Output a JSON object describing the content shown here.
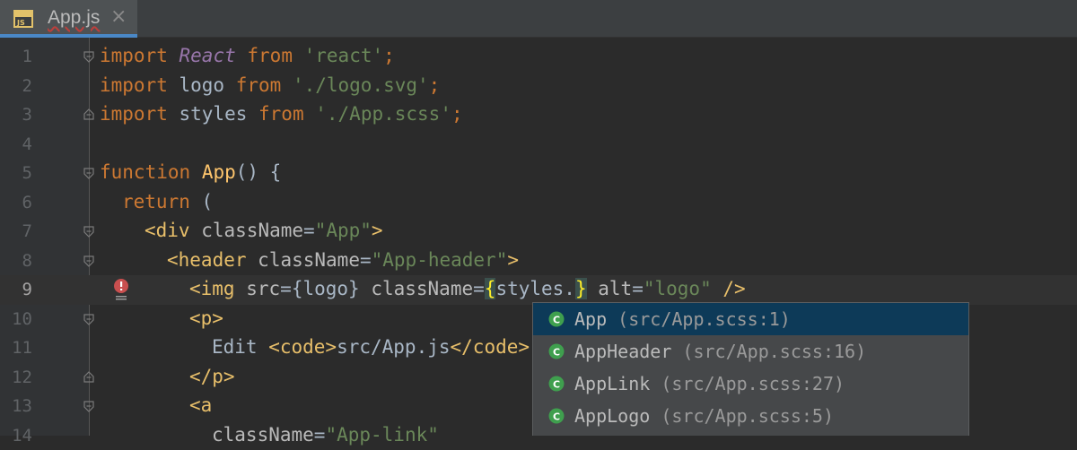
{
  "tab": {
    "title": "App.js",
    "icon_label": "JS",
    "close": "×"
  },
  "editor": {
    "current_line": 9,
    "lines": [
      {
        "n": "1"
      },
      {
        "n": "2"
      },
      {
        "n": "3"
      },
      {
        "n": "4"
      },
      {
        "n": "5"
      },
      {
        "n": "6"
      },
      {
        "n": "7"
      },
      {
        "n": "8"
      },
      {
        "n": "9"
      },
      {
        "n": "10"
      },
      {
        "n": "11"
      },
      {
        "n": "12"
      },
      {
        "n": "13"
      },
      {
        "n": "14"
      }
    ],
    "code": {
      "l1": [
        "import",
        "React",
        "from",
        "'react'",
        ";"
      ],
      "l2": [
        "import",
        " logo ",
        "from",
        "'./logo.svg'",
        ";"
      ],
      "l3": [
        "import",
        " styles ",
        "from",
        "'./App.scss'",
        ";"
      ],
      "l5": [
        "function",
        "App",
        "() {"
      ],
      "l6": [
        "return",
        " ("
      ],
      "l7": [
        "<div",
        "className",
        "=",
        "\"App\"",
        ">"
      ],
      "l8": [
        "<header",
        "className",
        "=",
        "\"App-header\"",
        ">"
      ],
      "l9": [
        "<img",
        "src",
        "={logo} ",
        "className",
        "=",
        "{",
        "styles.",
        "}",
        "alt",
        "=",
        "\"logo\"",
        " />"
      ],
      "l10": [
        "<p>"
      ],
      "l11": [
        "Edit ",
        "<code>",
        "src/App.js",
        "</code>"
      ],
      "l12": [
        "</p>"
      ],
      "l13": [
        "<a"
      ],
      "l14": [
        "className",
        "=",
        "\"App-link\""
      ]
    }
  },
  "completion": {
    "items": [
      {
        "name": "App",
        "location": "(src/App.scss:1)",
        "icon": "class-c-icon"
      },
      {
        "name": "AppHeader",
        "location": "(src/App.scss:16)",
        "icon": "class-c-icon"
      },
      {
        "name": "AppLink",
        "location": "(src/App.scss:27)",
        "icon": "class-c-icon"
      },
      {
        "name": "AppLogo",
        "location": "(src/App.scss:5)",
        "icon": "class-c-icon"
      }
    ],
    "selected_index": 0,
    "icon_letter": "C"
  },
  "colors": {
    "background": "#2b2b2b",
    "keyword": "#cc7832",
    "string": "#6a8759",
    "function": "#ffc66d",
    "selection": "#0d3a58",
    "tab_underline": "#4a88c7"
  }
}
